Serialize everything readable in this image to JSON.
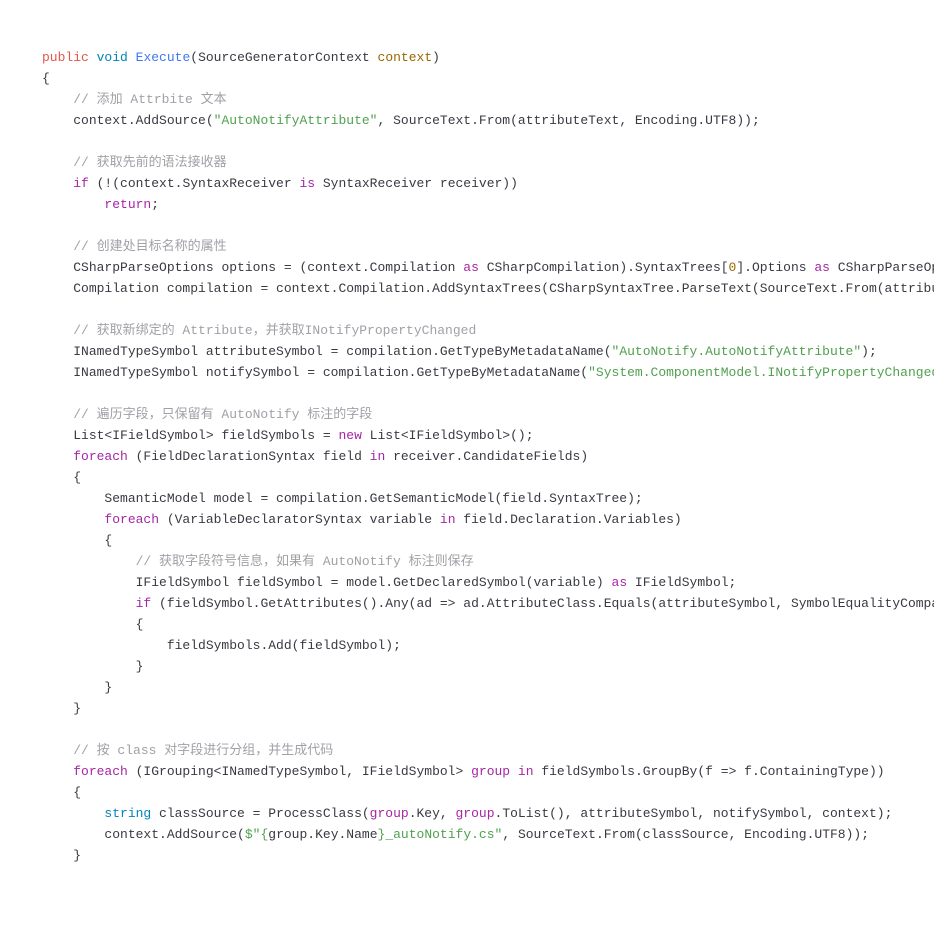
{
  "code": {
    "sig_public": "public",
    "sig_void": "void",
    "sig_method": "Execute",
    "sig_paramtype": "SourceGeneratorContext",
    "sig_paramname": "context",
    "open_brace": "{",
    "close_brace": "}",
    "c1": "// 添加 Attrbite 文本",
    "l1_a": "context.AddSource(",
    "l1_str": "\"AutoNotifyAttribute\"",
    "l1_b": ", SourceText.From(attributeText, Encoding.UTF8));",
    "c2": "// 获取先前的语法接收器",
    "l2_if": "if",
    "l2_a": " (!(context.SyntaxReceiver ",
    "l2_is": "is",
    "l2_b": " SyntaxReceiver receiver))",
    "l2_return": "return",
    "l2_semi": ";",
    "c3": "// 创建处目标名称的属性",
    "l3_a": "CSharpParseOptions options = (context.Compilation ",
    "l3_as": "as",
    "l3_b": " CSharpCompilation).SyntaxTrees[",
    "l3_num": "0",
    "l3_c": "].Options ",
    "l3_as2": "as",
    "l3_d": " CSharpParseOp",
    "l4_a": "Compilation compilation = context.Compilation.AddSyntaxTrees(CSharpSyntaxTree.ParseText(SourceText.From(attribu",
    "c4": "// 获取新绑定的 Attribute，并获取INotifyPropertyChanged",
    "l5_a": "INamedTypeSymbol attributeSymbol = compilation.GetTypeByMetadataName(",
    "l5_str": "\"AutoNotify.AutoNotifyAttribute\"",
    "l5_b": ");",
    "l6_a": "INamedTypeSymbol notifySymbol = compilation.GetTypeByMetadataName(",
    "l6_str": "\"System.ComponentModel.INotifyPropertyChanged",
    "c5": "// 遍历字段，只保留有 AutoNotify 标注的字段",
    "l7_a": "List<IFieldSymbol> fieldSymbols = ",
    "l7_new": "new",
    "l7_b": " List<IFieldSymbol>();",
    "l8_foreach": "foreach",
    "l8_a": " (FieldDeclarationSyntax field ",
    "l8_in": "in",
    "l8_b": " receiver.CandidateFields)",
    "l9_a": "SemanticModel model = compilation.GetSemanticModel(field.SyntaxTree);",
    "l10_foreach": "foreach",
    "l10_a": " (VariableDeclaratorSyntax variable ",
    "l10_in": "in",
    "l10_b": " field.Declaration.Variables)",
    "c6": "// 获取字段符号信息，如果有 AutoNotify 标注则保存",
    "l11_a": "IFieldSymbol fieldSymbol = model.GetDeclaredSymbol(variable) ",
    "l11_as": "as",
    "l11_b": " IFieldSymbol;",
    "l12_if": "if",
    "l12_a": " (fieldSymbol.GetAttributes().Any(ad => ad.AttributeClass.Equals(attributeSymbol, SymbolEqualityCompa",
    "l13_a": "fieldSymbols.Add(fieldSymbol);",
    "c7": "// 按 class 对字段进行分组，并生成代码",
    "l14_foreach": "foreach",
    "l14_a": " (IGrouping<INamedTypeSymbol, IFieldSymbol> ",
    "l14_group": "group",
    "l14_b": " ",
    "l14_in": "in",
    "l14_c": " fieldSymbols.GroupBy(f => f.ContainingType))",
    "l15_string": "string",
    "l15_a": " classSource = ProcessClass(",
    "l15_group1": "group",
    "l15_b": ".Key, ",
    "l15_group2": "group",
    "l15_c": ".ToList(), attributeSymbol, notifySymbol, context);",
    "l16_a": "context.AddSource(",
    "l16_interp_start": "$\"",
    "l16_interp_open": "{",
    "l16_interp_expr": "group.Key.Name",
    "l16_interp_close": "}",
    "l16_interp_rest": "_autoNotify.cs\"",
    "l16_b": ", SourceText.From(classSource, Encoding.UTF8));"
  }
}
